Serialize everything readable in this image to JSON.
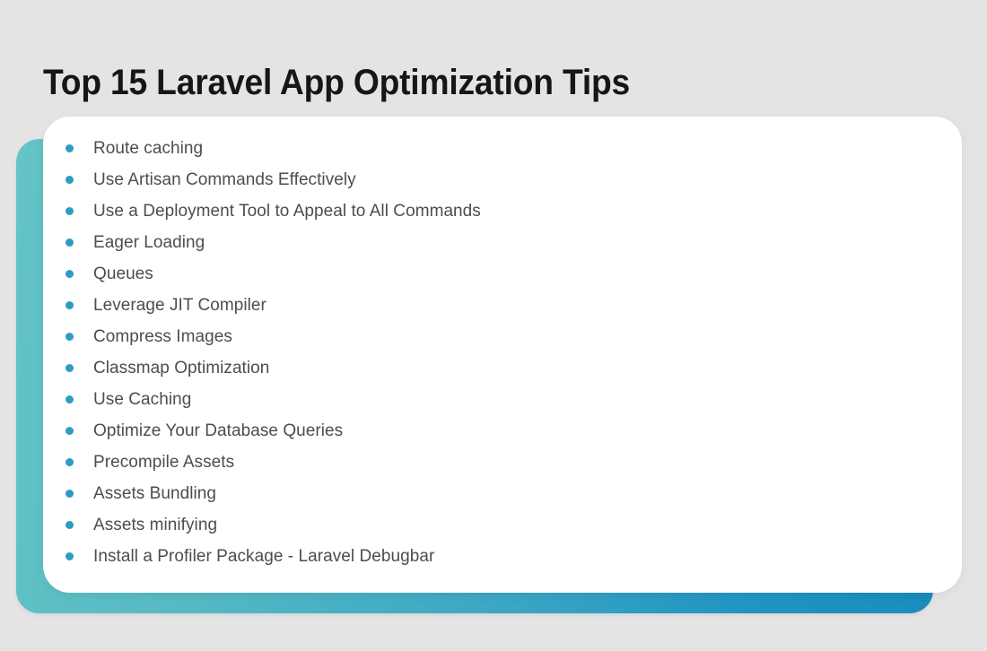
{
  "page": {
    "title": "Top 15 Laravel App Optimization Tips",
    "background_color": "#e4e4e4",
    "card_color": "#ffffff",
    "accent_gradient_start": "#64c4c6",
    "accent_gradient_end": "#1a8cbe",
    "bullet_color": "#2e9bc4",
    "text_color": "#4d4d4d",
    "title_color": "#161616"
  },
  "tips": [
    {
      "label": "Route caching"
    },
    {
      "label": "Use Artisan Commands Effectively"
    },
    {
      "label": "Use a Deployment Tool to Appeal to All Commands"
    },
    {
      "label": "Eager Loading"
    },
    {
      "label": "Queues"
    },
    {
      "label": "Leverage JIT Compiler"
    },
    {
      "label": "Compress Images"
    },
    {
      "label": "Classmap Optimization"
    },
    {
      "label": "Use Caching"
    },
    {
      "label": "Optimize Your Database Queries"
    },
    {
      "label": "Precompile Assets"
    },
    {
      "label": "Assets Bundling"
    },
    {
      "label": "Assets minifying"
    },
    {
      "label": "Install a Profiler Package - Laravel Debugbar"
    }
  ]
}
